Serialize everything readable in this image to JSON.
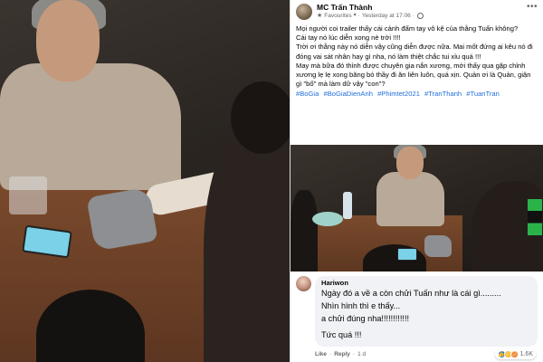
{
  "post": {
    "author": "MC Trấn Thành",
    "audience": "Favourites",
    "timestamp": "Yesterday at 17:06",
    "lines": [
      "Mọi người coi trailer thấy cái cảnh đấm tay vô kệ của thằng Tuấn không?",
      "Cái tay nó lúc diễn xong nè trời !!!!",
      "Trời ơi thằng này nó diễn vậy cũng diễn được nữa. Mai mốt đứng ai kêu nó đi đóng vai sát nhân hay gì nha, nó làm thiệt chắc tui xỉu quá !!!",
      "May mà bữa đó thỉnh được chuyên gia nắn xương, mới thấy qua gặp chỉnh xương lẹ lẹ xong băng bó thầy đi ăn liên luôn, quá xịn. Quản ơi là Quản, giận gì \"bố\" mà làm dữ vậy \"con\"?"
    ],
    "hashtags": [
      "#BoGia",
      "#BoGiaDienAnh",
      "#Phimtet2021",
      "#TranThanh",
      "#TuanTran"
    ]
  },
  "comment": {
    "author": "Hariwon",
    "lines": [
      "Ngày đó a về a còn chửi Tuấn như là cái gì.........",
      "Nhìn hình thì e thấy...",
      "a chửi đúng nha!!!!!!!!!!!!",
      "Tức quá !!!"
    ],
    "actions": {
      "like": "Like",
      "reply": "Reply",
      "age": "1 d"
    },
    "reactions": {
      "count": "1.6K",
      "icons": [
        "like-icon",
        "haha-icon",
        "angry-icon"
      ]
    }
  },
  "colors": {
    "hashtag": "#216fdb",
    "bubble": "#f0f2f5",
    "meta_text": "#65676b",
    "like_blue": "#1877f2"
  }
}
